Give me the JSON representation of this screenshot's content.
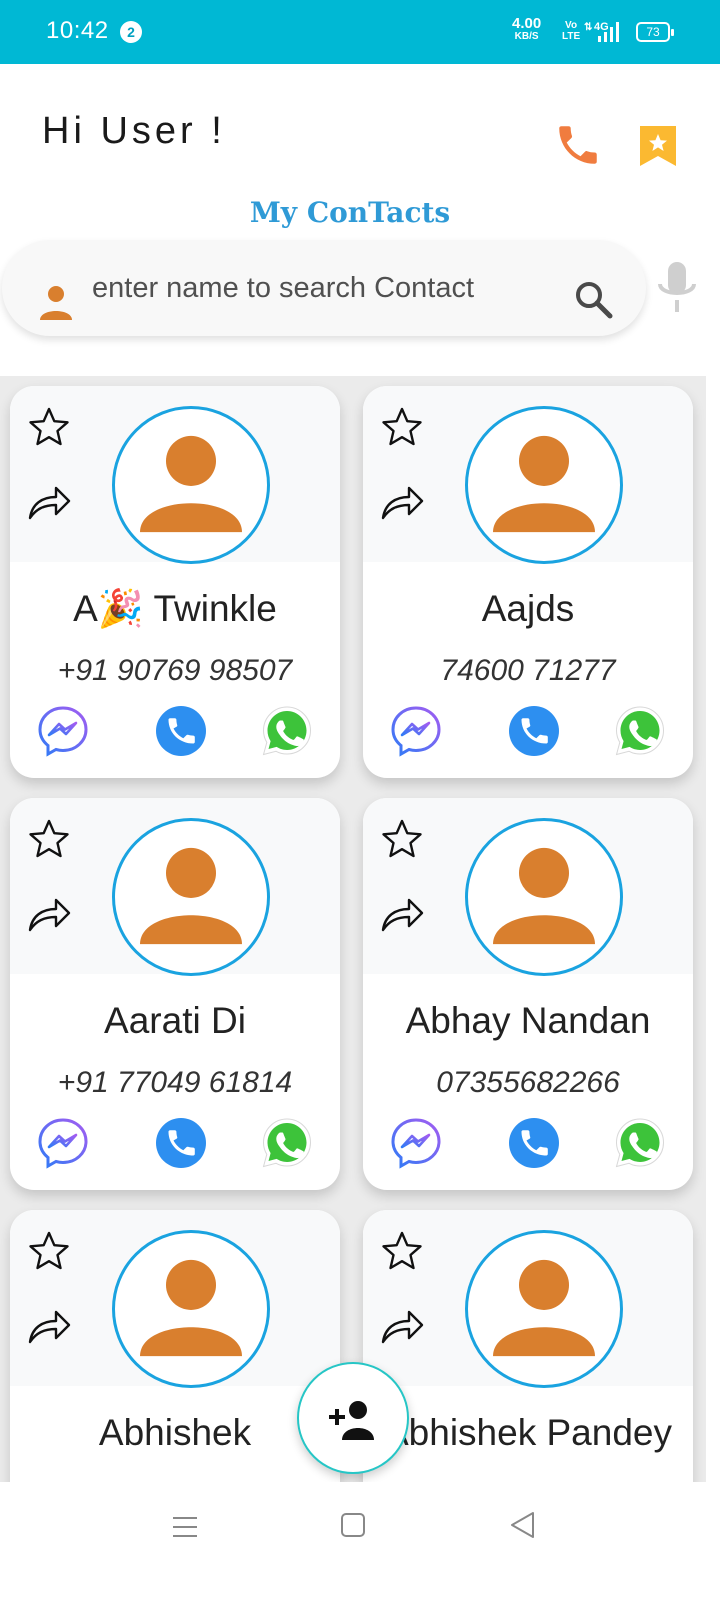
{
  "status_bar": {
    "time": "10:42",
    "notification_count": "2",
    "net_speed": "4.00",
    "net_speed_unit": "KB/S",
    "volte_top": "Vo",
    "volte_bottom": "LTE",
    "network_type": "4G",
    "battery": "73"
  },
  "header": {
    "greeting": "Hi User !",
    "title": "My ConTacts",
    "call_icon": "phone-icon",
    "bookmark_icon": "bookmark-star-icon"
  },
  "search": {
    "placeholder": "enter name to search Contact",
    "value": ""
  },
  "colors": {
    "status_bar": "#00b8d4",
    "accent_orange": "#f07c3f",
    "bookmark_yellow": "#fbb931",
    "title_blue": "#2f9ad6",
    "avatar_border": "#1aa3e0",
    "avatar_fill": "#d97f2e"
  },
  "contacts": [
    {
      "name": "A🎉 Twinkle",
      "phone": "+91 90769 98507"
    },
    {
      "name": "Aajds",
      "phone": "74600 71277"
    },
    {
      "name": "Aarati Di",
      "phone": "+91 77049 61814"
    },
    {
      "name": "Abhay Nandan",
      "phone": "07355682266"
    },
    {
      "name": "Abhishek",
      "phone": ""
    },
    {
      "name": "Abhishek Pandey",
      "phone": ""
    }
  ],
  "card_icons": [
    "star-outline-icon",
    "share-icon",
    "messenger-icon",
    "call-icon",
    "whatsapp-icon"
  ],
  "fab_icon": "add-person-icon",
  "nav_icons": [
    "recents-menu-icon",
    "home-square-icon",
    "back-triangle-icon"
  ]
}
